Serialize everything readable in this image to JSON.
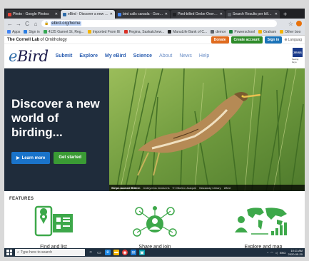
{
  "browser": {
    "tabs": [
      {
        "label": "Photo - Google Photos",
        "favicon_color": "#ea4335",
        "active": false
      },
      {
        "label": "eBird - Discover a new wor",
        "favicon_color": "#2e6ba8",
        "active": true
      },
      {
        "label": "bird calls canada - Google",
        "favicon_color": "#4285f4",
        "active": false
      },
      {
        "label": "Pied-billed Grebe Overvie",
        "favicon_color": "#202124",
        "active": false
      },
      {
        "label": "Search Results per killed p",
        "favicon_color": "#5f6368",
        "active": false
      }
    ],
    "new_tab": "+",
    "back": "←",
    "forward": "→",
    "reload": "C",
    "home": "⌂",
    "url": "ebird.org/home",
    "bookmarks": [
      {
        "label": "Apps",
        "color": "#4285f4"
      },
      {
        "label": "Sign in",
        "color": "#2a7de1"
      },
      {
        "label": "4125 Garnet St, Reg...",
        "color": "#34a853"
      },
      {
        "label": "Imported From IE",
        "color": "#f4b400"
      },
      {
        "label": "Regina, Saskatchew...",
        "color": "#d93025"
      },
      {
        "label": "ManuLife Bank of C...",
        "color": "#202124"
      },
      {
        "label": "demor",
        "color": "#5f6368"
      },
      {
        "label": "Powerschool",
        "color": "#1b7f3b"
      },
      {
        "label": "Graham",
        "color": "#f4b400"
      },
      {
        "label": "Other boo",
        "color": "#f4b400"
      }
    ]
  },
  "cornell": {
    "logo_text_bold": "The Cornell Lab",
    "logo_text": "of Ornithology",
    "donate": "Donate",
    "create_account": "Create account",
    "sign_in": "Sign in",
    "language": "Languag"
  },
  "ebird": {
    "logo_e": "e",
    "logo_bird": "Bird",
    "nav": [
      {
        "label": "Submit",
        "light": false
      },
      {
        "label": "Explore",
        "light": false
      },
      {
        "label": "My eBird",
        "light": false
      },
      {
        "label": "Science",
        "light": false
      },
      {
        "label": "About",
        "light": true
      },
      {
        "label": "News",
        "light": true
      },
      {
        "label": "Help",
        "light": true
      }
    ],
    "zeiss_logo": "ZEISS",
    "zeiss_tagline": "Seeing beyo"
  },
  "hero": {
    "title": "Discover a new world of birding...",
    "learn_more": "Learn more",
    "get_started": "Get started",
    "caption_species": "Stripe-backed Bittern",
    "caption_latin": "Ixobrychus involucris",
    "caption_credit": "© Ottorino Joaquín",
    "caption_library": "Macaulay Library",
    "caption_ebird": "eBird"
  },
  "features": {
    "heading": "FEATURES",
    "items": [
      {
        "label": "Find and list"
      },
      {
        "label": "Share and join"
      },
      {
        "label": "Explore and map"
      }
    ]
  },
  "taskbar": {
    "search_placeholder": "Type here to search",
    "lang": "ENG",
    "time": "10:11 AM",
    "date": "2020-05-20"
  },
  "colors": {
    "accent_blue": "#2a5db0",
    "hero_dark": "#1f2c3b",
    "feature_green": "#3da84a"
  }
}
